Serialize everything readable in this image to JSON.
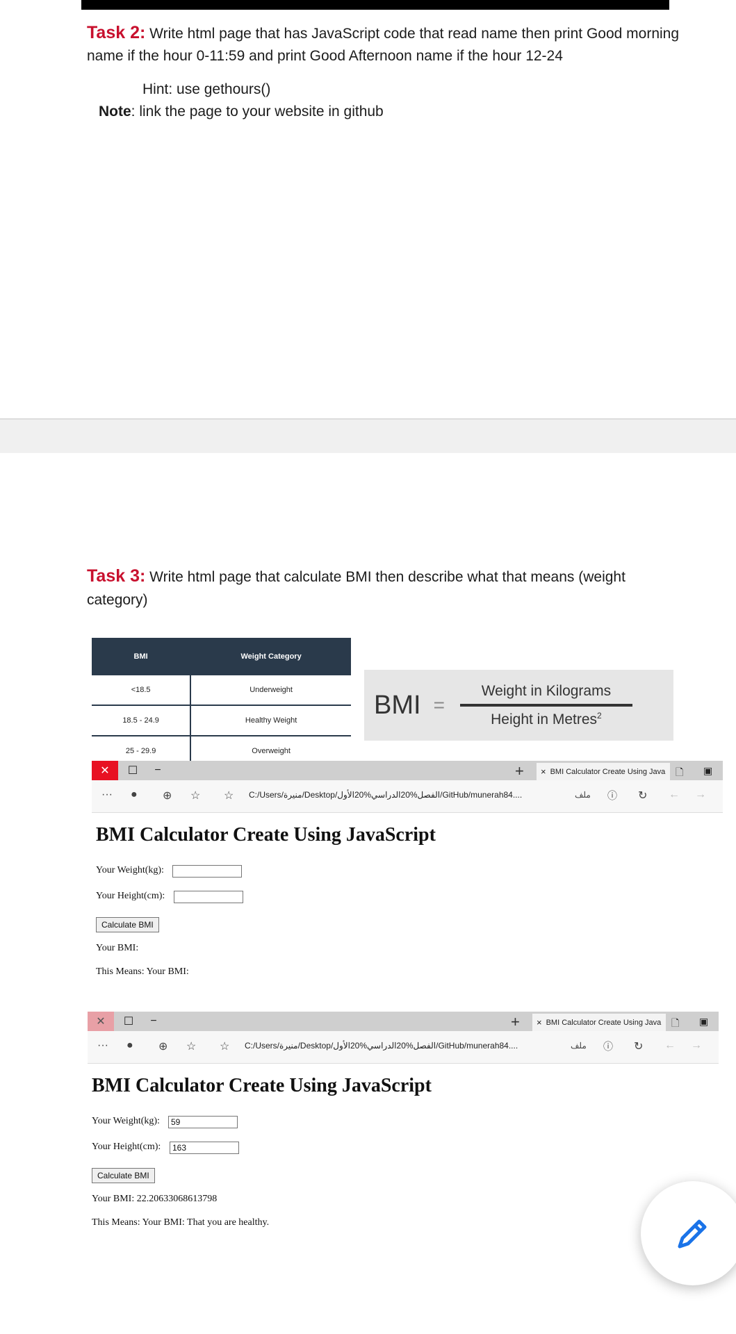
{
  "task2": {
    "label": "Task 2:",
    "line1": "Write html page that has JavaScript code that read name then print Good morning",
    "line2": "name if the hour 0-11:59 and print Good Afternoon name if the hour 12-24",
    "hint": "Hint: use gethours()",
    "note_label": "Note",
    "note_text": ": link the page to your website in github"
  },
  "task3": {
    "label": "Task 3:",
    "line1": "Write html page that calculate BMI then describe what that means (weight",
    "line2": "category)"
  },
  "bmi_table": {
    "headers": [
      "BMI",
      "Weight Category"
    ],
    "rows": [
      [
        "<18.5",
        "Underweight"
      ],
      [
        "18.5 - 24.9",
        "Healthy Weight"
      ],
      [
        "25 - 29.9",
        "Overweight"
      ]
    ]
  },
  "formula": {
    "lhs": "BMI",
    "eq": "=",
    "numerator": "Weight in Kilograms",
    "denominator": "Height in Metres",
    "exponent": "2"
  },
  "browser1": {
    "close": "✕",
    "restore": "☐",
    "minimize": "−",
    "new_tab": "+",
    "tab_close": "×",
    "tab_title": "BMI Calculator Create Using Java",
    "more": "···",
    "url": "C:/Users/منيرة/Desktop/الفصل%20الدراسي%20الأول/GitHub/munerah84....",
    "file_label": "ملف",
    "page_title": "BMI Calculator Create Using JavaScript",
    "weight_label": "Your Weight(kg):",
    "weight_value": "",
    "height_label": "Your Height(cm):",
    "height_value": "",
    "button": "Calculate BMI",
    "bmi_result": "Your BMI:",
    "means": "This Means: Your BMI:"
  },
  "browser2": {
    "close": "✕",
    "restore": "☐",
    "minimize": "−",
    "new_tab": "+",
    "tab_close": "×",
    "tab_title": "BMI Calculator Create Using Java",
    "more": "···",
    "url": "C:/Users/منيرة/Desktop/الفصل%20الدراسي%20الأول/GitHub/munerah84....",
    "file_label": "ملف",
    "page_title": "BMI Calculator Create Using JavaScript",
    "weight_label": "Your Weight(kg):",
    "weight_value": "59",
    "height_label": "Your Height(cm):",
    "height_value": "163",
    "button": "Calculate BMI",
    "bmi_result": "Your BMI: 22.20633068613798",
    "means": "This Means: Your BMI: That you are healthy."
  },
  "icons": [
    "close-icon",
    "restore-icon",
    "minimize-icon",
    "plus-icon",
    "page-icon",
    "sidebar-icon",
    "profile-icon",
    "extensions-icon",
    "favorites-icon",
    "info-icon",
    "refresh-icon",
    "back-icon",
    "forward-icon",
    "pencil-icon"
  ],
  "colors": {
    "task_label": "#c8102e",
    "table_header": "#2a3a4b",
    "close_button": "#e81123",
    "fab_pencil": "#1a73e8"
  }
}
